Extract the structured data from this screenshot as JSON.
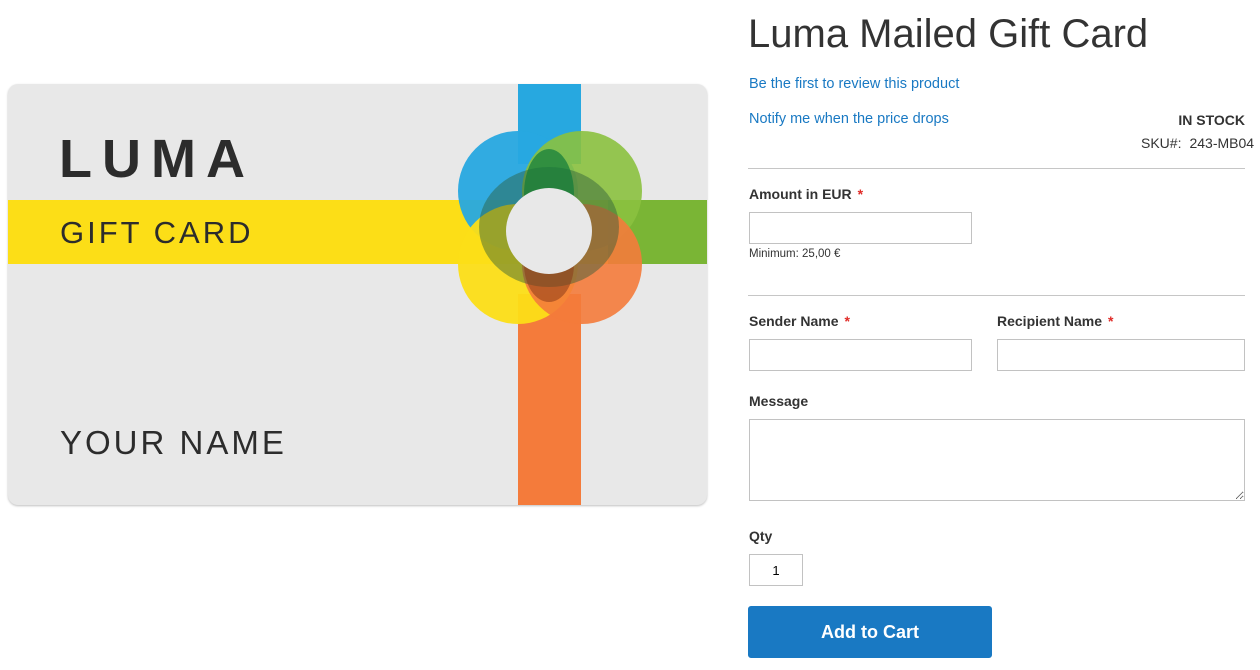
{
  "product": {
    "card_image": {
      "logo": "LUMA",
      "subtitle": "GIFT CARD",
      "name": "YOUR NAME",
      "colors": {
        "background": "#e8e8e8",
        "yellow": "#fcde17",
        "blue": "#27a8e0",
        "green": "#8bc13f",
        "orange": "#f47b3b"
      }
    },
    "title": "Luma Mailed Gift Card",
    "review_link": "Be the first to review this product",
    "price_alert_link": "Notify me when the price drops",
    "stock_status": "IN STOCK",
    "sku_label": "SKU#:",
    "sku_value": "243-MB04"
  },
  "form": {
    "amount": {
      "label": "Amount in EUR",
      "required_mark": "*",
      "value": "",
      "note": "Minimum: 25,00 €"
    },
    "sender": {
      "label": "Sender Name",
      "required_mark": "*",
      "value": ""
    },
    "recipient": {
      "label": "Recipient Name",
      "required_mark": "*",
      "value": ""
    },
    "message": {
      "label": "Message",
      "value": ""
    },
    "qty": {
      "label": "Qty",
      "value": "1"
    },
    "add_to_cart": "Add to Cart"
  },
  "colors": {
    "accent": "#1979c3",
    "required": "#e02b27",
    "text": "#333333"
  }
}
